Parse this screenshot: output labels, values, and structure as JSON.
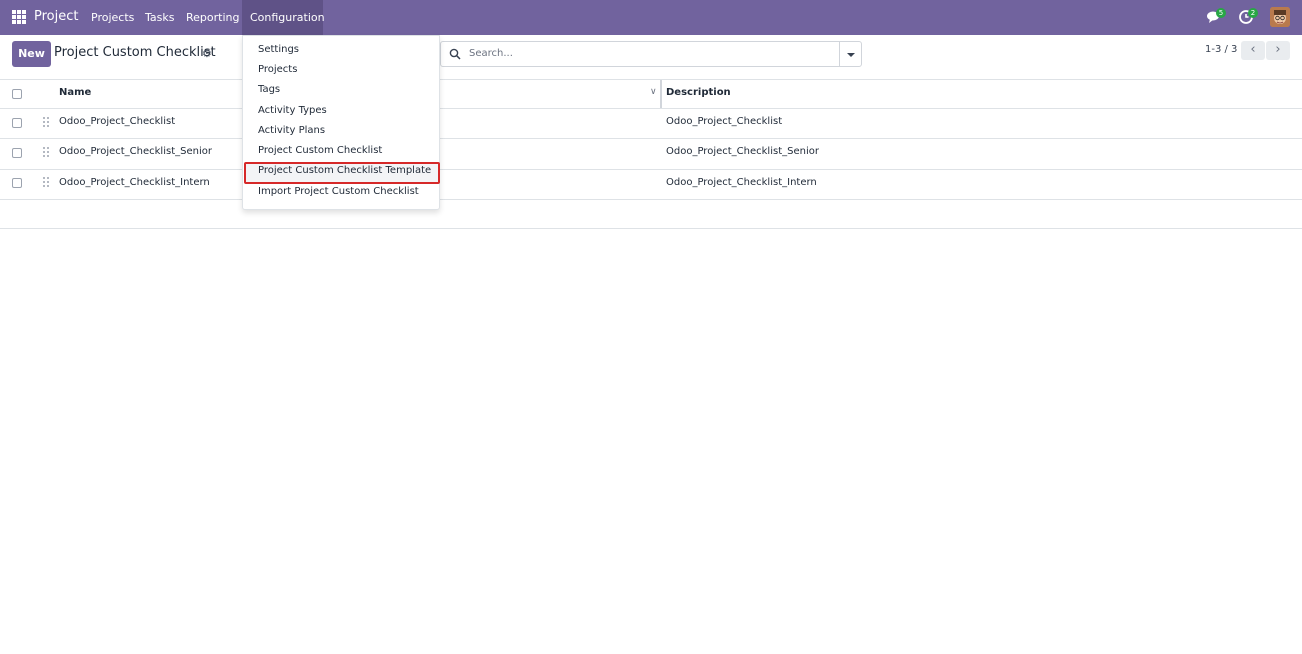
{
  "navbar": {
    "brand": "Project",
    "menu": [
      "Projects",
      "Tasks",
      "Reporting",
      "Configuration"
    ],
    "messages_count": "5",
    "activities_count": "2",
    "bg_color": "#71639e",
    "icons": [
      "apps-grid-icon",
      "chat-icon",
      "clock-icon",
      "avatar"
    ]
  },
  "control_panel": {
    "new_label": "New",
    "title": "Project Custom Checklist",
    "search_placeholder": "Search...",
    "pager": "1-3 / 3"
  },
  "table": {
    "columns": [
      "Name",
      "Description"
    ],
    "rows": [
      {
        "name": "Odoo_Project_Checklist",
        "description": "Odoo_Project_Checklist"
      },
      {
        "name": "Odoo_Project_Checklist_Senior",
        "description": "Odoo_Project_Checklist_Senior"
      },
      {
        "name": "Odoo_Project_Checklist_Intern",
        "description": "Odoo_Project_Checklist_Intern"
      }
    ]
  },
  "config_menu": {
    "items": [
      "Settings",
      "Projects",
      "Tags",
      "Activity Types",
      "Activity Plans",
      "Project Custom Checklist",
      "Project Custom Checklist Template",
      "Import Project Custom Checklist"
    ],
    "highlighted": "Project Custom Checklist Template",
    "highlight_color": "#d62929"
  }
}
